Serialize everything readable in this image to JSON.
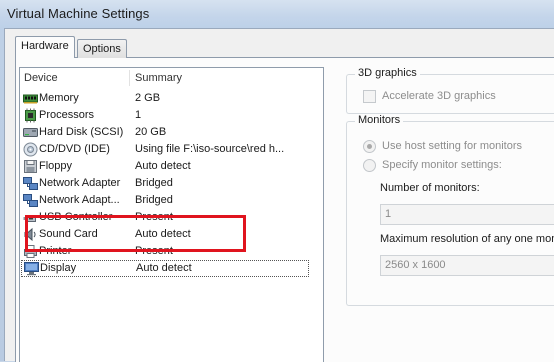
{
  "window": {
    "title": "Virtual Machine Settings"
  },
  "tabs": [
    {
      "label": "Hardware",
      "selected": true
    },
    {
      "label": "Options",
      "selected": false
    }
  ],
  "device_list": {
    "columns": [
      "Device",
      "Summary"
    ],
    "rows": [
      {
        "device": "Memory",
        "summary": "2 GB",
        "icon": "memory-icon"
      },
      {
        "device": "Processors",
        "summary": "1",
        "icon": "processor-icon"
      },
      {
        "device": "Hard Disk (SCSI)",
        "summary": "20 GB",
        "icon": "hard-disk-icon"
      },
      {
        "device": "CD/DVD (IDE)",
        "summary": "Using file F:\\iso-source\\red h...",
        "icon": "cd-dvd-icon"
      },
      {
        "device": "Floppy",
        "summary": "Auto detect",
        "icon": "floppy-icon"
      },
      {
        "device": "Network Adapter",
        "summary": "Bridged",
        "icon": "network-adapter-icon"
      },
      {
        "device": "Network Adapt...",
        "summary": "Bridged",
        "icon": "network-adapter-icon"
      },
      {
        "device": "USB Controller",
        "summary": "Present",
        "icon": "usb-icon"
      },
      {
        "device": "Sound Card",
        "summary": "Auto detect",
        "icon": "sound-card-icon"
      },
      {
        "device": "Printer",
        "summary": "Present",
        "icon": "printer-icon"
      },
      {
        "device": "Display",
        "summary": "Auto detect",
        "icon": "display-icon",
        "focused": true
      }
    ]
  },
  "graphics_3d": {
    "legend": "3D graphics",
    "accelerate_label": "Accelerate 3D graphics",
    "accelerate_checked": false
  },
  "monitors": {
    "legend": "Monitors",
    "options": [
      {
        "label": "Use host setting for monitors",
        "selected": true
      },
      {
        "label": "Specify monitor settings:",
        "selected": false
      }
    ],
    "number_label": "Number of monitors:",
    "number_value": "1",
    "max_res_label": "Maximum resolution of any one monitor",
    "max_res_value": "2560 x 1600"
  },
  "colors": {
    "highlight_box": "#e0141e",
    "titlebar": "#c4d5ea"
  }
}
